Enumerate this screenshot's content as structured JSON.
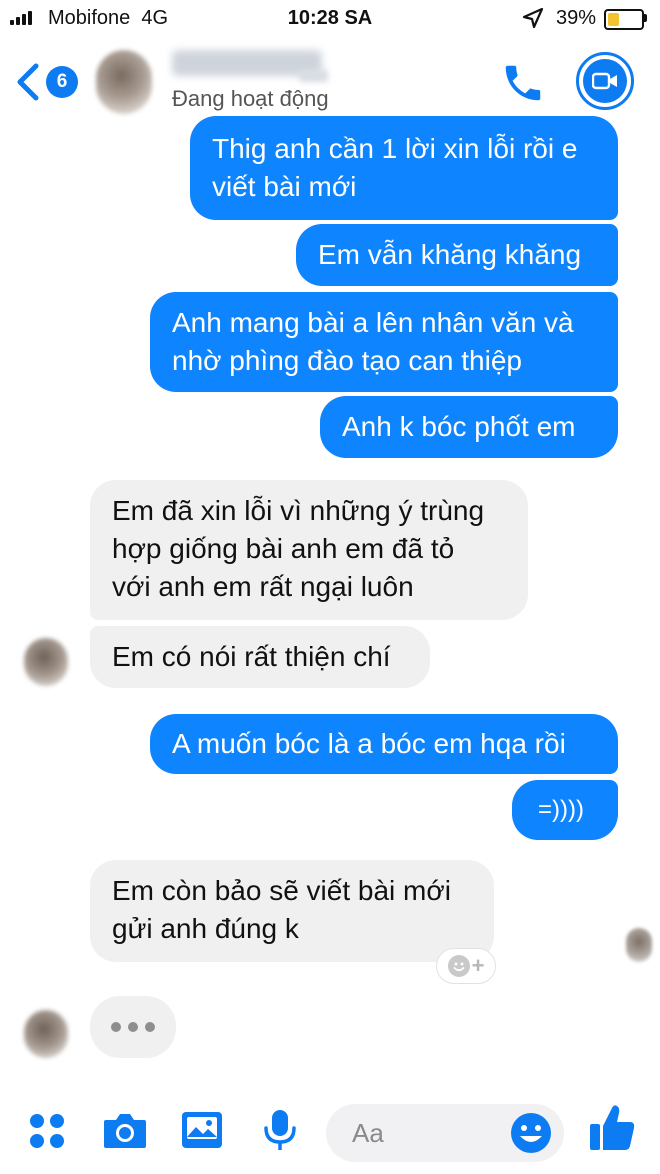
{
  "status_bar": {
    "carrier": "Mobifone",
    "network": "4G",
    "time": "10:28 SA",
    "battery_percent": "39%",
    "battery_level": 0.39
  },
  "header": {
    "unread_count": "6",
    "contact_status": "Đang hoạt động",
    "icons": [
      "back-chevron-icon",
      "phone-icon",
      "video-camera-icon"
    ]
  },
  "messages": [
    {
      "direction": "out",
      "text": "Thig anh cần 1 lời xin lỗi rồi e\nviết bài mới"
    },
    {
      "direction": "out",
      "text": "Em vẫn khăng khăng"
    },
    {
      "direction": "out",
      "text": "Anh mang bài a lên nhân văn và\nnhờ phìng đào tạo can thiệp"
    },
    {
      "direction": "out",
      "text": "Anh k bóc phốt em"
    },
    {
      "direction": "in",
      "text": "Em đã xin lỗi vì những ý trùng\nhợp giống bài anh em đã tỏ\nvới anh em rất ngại luôn"
    },
    {
      "direction": "in",
      "text": "Em có nói rất thiện chí"
    },
    {
      "direction": "out",
      "text": "A muốn bóc là a bóc em hqa rồi"
    },
    {
      "direction": "out",
      "text": "=))))"
    },
    {
      "direction": "in",
      "text": "Em còn bảo sẽ viết bài mới\ngửi  anh đúng k"
    }
  ],
  "reaction_button": {
    "plus": "+"
  },
  "composer": {
    "placeholder": "Aa",
    "icons": [
      "apps-icon",
      "camera-icon",
      "gallery-icon",
      "microphone-icon",
      "emoji-icon",
      "thumbs-up-icon"
    ]
  },
  "colors": {
    "accent": "#0d7bf2",
    "outgoing_bubble": "#0f84ff",
    "incoming_bubble": "#f0f0f0"
  }
}
